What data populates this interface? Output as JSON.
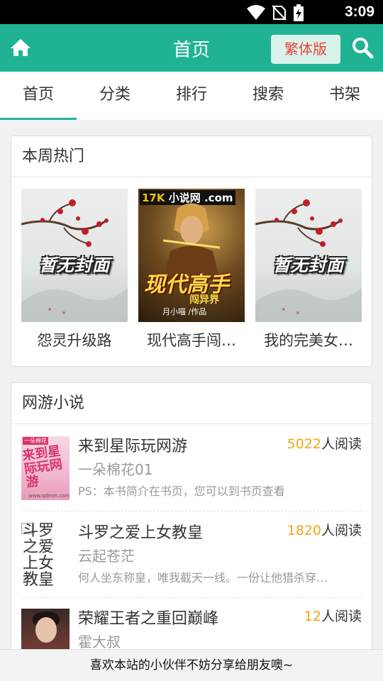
{
  "status_bar": {
    "time": "3:09",
    "icons": [
      "wifi-icon",
      "no-sim-icon",
      "battery-charging-icon"
    ]
  },
  "header": {
    "title": "首页",
    "traditional_button": "繁体版",
    "home_icon": "home-icon",
    "search_icon": "search-icon",
    "brand_color": "#1fb394"
  },
  "tabs": [
    {
      "label": "首页",
      "active": true
    },
    {
      "label": "分类",
      "active": false
    },
    {
      "label": "排行",
      "active": false
    },
    {
      "label": "搜索",
      "active": false
    },
    {
      "label": "书架",
      "active": false
    }
  ],
  "hot_section": {
    "title": "本周热门",
    "books": [
      {
        "name": "怨灵升级路",
        "cover_text": "暂无封面"
      },
      {
        "name": "现代高手闯…",
        "cover_logo": "17K",
        "cover_logo_sub": "小说网",
        "cover_logo_domain": ".com",
        "cover_title": "现代高手",
        "cover_subtitle": "闯异界",
        "cover_author": "月小喵 /作品"
      },
      {
        "name": "我的完美女…",
        "cover_text": "暂无封面"
      }
    ]
  },
  "online_game_section": {
    "title": "网游小说",
    "books": [
      {
        "title": "来到星际玩网游",
        "reads": "5022",
        "reads_suffix": "人阅读",
        "author": "一朵棉花01",
        "desc": "PS：本书简介在书页，您可以到书页查看",
        "cover_top": "一朵棉花",
        "cover_title": "来到星际玩网游",
        "cover_footer": "www.qdmm.com"
      },
      {
        "title": "斗罗之爱上女教皇",
        "reads": "1820",
        "reads_suffix": "人阅读",
        "author": "云起苍茫",
        "desc": "何人坐东称皇，唯我截天一线。一份让他猎杀穿…",
        "cover_alt": "斗罗之爱上女教皇"
      },
      {
        "title": "荣耀王者之重回巅峰",
        "reads": "12",
        "reads_suffix": "人阅读",
        "author": "霍大叔"
      }
    ],
    "accent_color": "#f4a418"
  },
  "footer": {
    "share_text": "喜欢本站的小伙伴不妨分享给朋友噢~"
  }
}
